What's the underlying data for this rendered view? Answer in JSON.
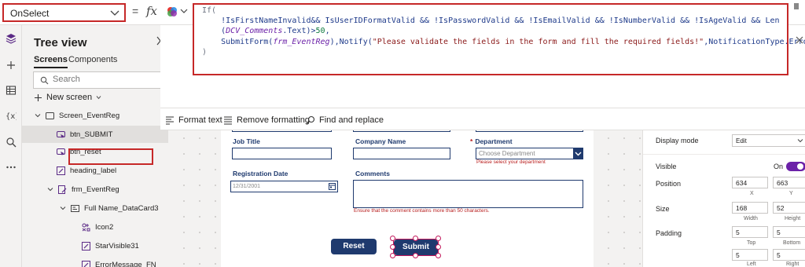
{
  "topbar": {
    "property_value": "OnSelect",
    "equals": "=",
    "fx": "fx"
  },
  "formula": {
    "line1": "If(",
    "line2_a": "    !IsFirstNameInvalid&& IsUserIDFormatValid && !IsPasswordValid && !IsEmailValid && !IsNumberValid && !IsAgeValid && Len",
    "line3_a": "    (",
    "line3_ctrl": "DCV_Comments",
    "line3_b": ".Text)>",
    "line3_num": "50",
    "line3_c": ",",
    "line4_a": "    SubmitForm(",
    "line4_ctrl": "frm_EventReg",
    "line4_b": "),Notify(",
    "line4_str": "\"Please validate the fields in the form and fill the required fields!\"",
    "line4_c": ",NotificationType.Error)",
    "line5": ")"
  },
  "format_toolbar": {
    "format_text": "Format text",
    "remove_formatting": "Remove formatting",
    "find_replace": "Find and replace"
  },
  "tree": {
    "title": "Tree view",
    "tabs": [
      "Screens",
      "Components"
    ],
    "search_placeholder": "Search",
    "new_screen": "New screen",
    "items": [
      {
        "label": "Screen_EventReg"
      },
      {
        "label": "btn_SUBMIT"
      },
      {
        "label": "btn_reset"
      },
      {
        "label": "heading_label"
      },
      {
        "label": "frm_EventReg"
      },
      {
        "label": "Full Name_DataCard3"
      },
      {
        "label": "Icon2"
      },
      {
        "label": "StarVisible31"
      },
      {
        "label": "ErrorMessage_FN"
      }
    ]
  },
  "form": {
    "job_title_label": "Job Title",
    "company_label": "Company Name",
    "department_label": "Department",
    "department_required": "*",
    "department_placeholder": "Choose Department",
    "department_error": "Please select your department",
    "reg_date_label": "Registration Date",
    "reg_date_value": "12/31/2001",
    "comments_label": "Comments",
    "comments_error": "Ensure that the comment contains more than 50 characters.",
    "reset_label": "Reset",
    "submit_label": "Submit"
  },
  "properties": {
    "display_mode_label": "Display mode",
    "display_mode_value": "Edit",
    "visible_label": "Visible",
    "visible_value": "On",
    "position_label": "Position",
    "position_x": "634",
    "position_y": "663",
    "x_label": "X",
    "y_label": "Y",
    "size_label": "Size",
    "size_width": "168",
    "size_height": "52",
    "width_label": "Width",
    "height_label": "Height",
    "padding_label": "Padding",
    "padding_top": "5",
    "padding_bottom": "5",
    "padding_left": "5",
    "padding_right": "5",
    "top_label": "Top",
    "bottom_label": "Bottom",
    "left_label": "Left",
    "right_label": "Right"
  },
  "colors": {
    "accent": "#1f3a6e",
    "error": "#b71c1c",
    "highlight": "#c62828",
    "toggle": "#6b21a8"
  }
}
